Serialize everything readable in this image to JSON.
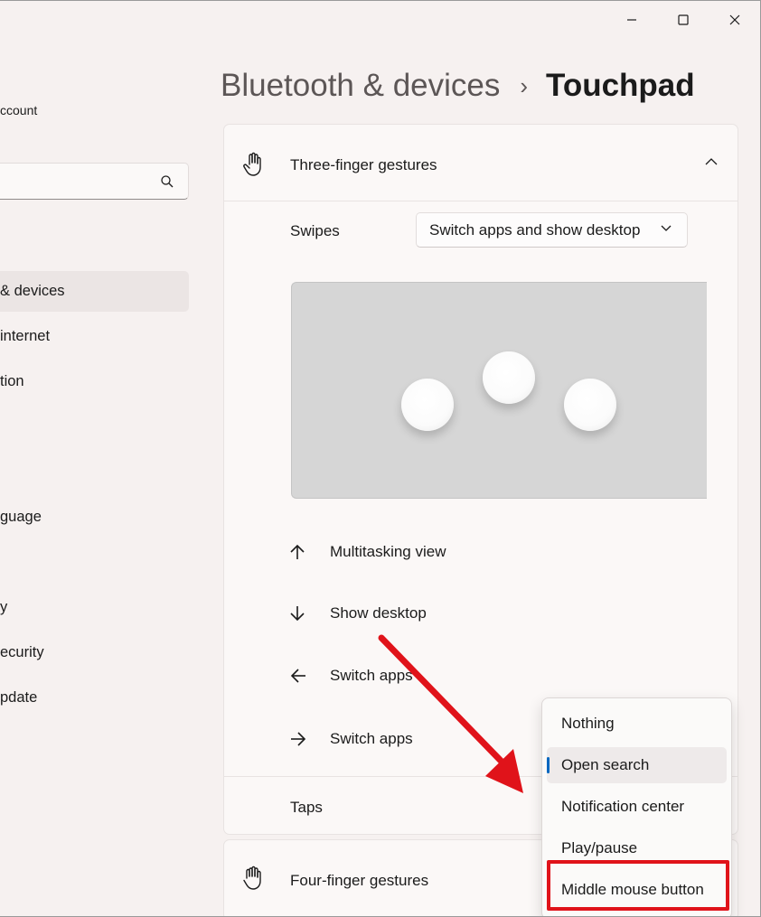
{
  "window": {
    "caption": {
      "minimize_icon": "minimize-icon",
      "maximize_icon": "maximize-icon",
      "close_icon": "close-icon"
    }
  },
  "sidebar": {
    "account_text": "ccount",
    "search": {
      "value": "",
      "icon": "search-icon"
    },
    "items": [
      {
        "label": "& devices",
        "active": true
      },
      {
        "label": " internet"
      },
      {
        "label": "tion"
      },
      {
        "label": "guage"
      },
      {
        "label": "y"
      },
      {
        "label": "ecurity"
      },
      {
        "label": "pdate"
      }
    ]
  },
  "header": {
    "parent": "Bluetooth & devices",
    "separator": "›",
    "current": "Touchpad"
  },
  "three_finger": {
    "title": "Three-finger gestures",
    "icon": "hand-gesture-icon",
    "expanded": true,
    "swipes_label": "Swipes",
    "swipes_value": "Switch apps and show desktop",
    "gestures": [
      {
        "direction": "up",
        "label": "Multitasking view"
      },
      {
        "direction": "down",
        "label": "Show desktop"
      },
      {
        "direction": "left",
        "label": "Switch apps"
      },
      {
        "direction": "right",
        "label": "Switch apps"
      }
    ],
    "taps_label": "Taps"
  },
  "four_finger": {
    "title": "Four-finger gestures",
    "icon": "hand-gesture-icon"
  },
  "taps_menu": {
    "options": [
      "Nothing",
      "Open search",
      "Notification center",
      "Play/pause",
      "Middle mouse button"
    ],
    "selected": "Open search",
    "highlighted": "Middle mouse button"
  },
  "colors": {
    "accent": "#0067c0",
    "annotation": "#e0131a",
    "background": "#f6f1f0",
    "card": "#fbf8f7"
  }
}
